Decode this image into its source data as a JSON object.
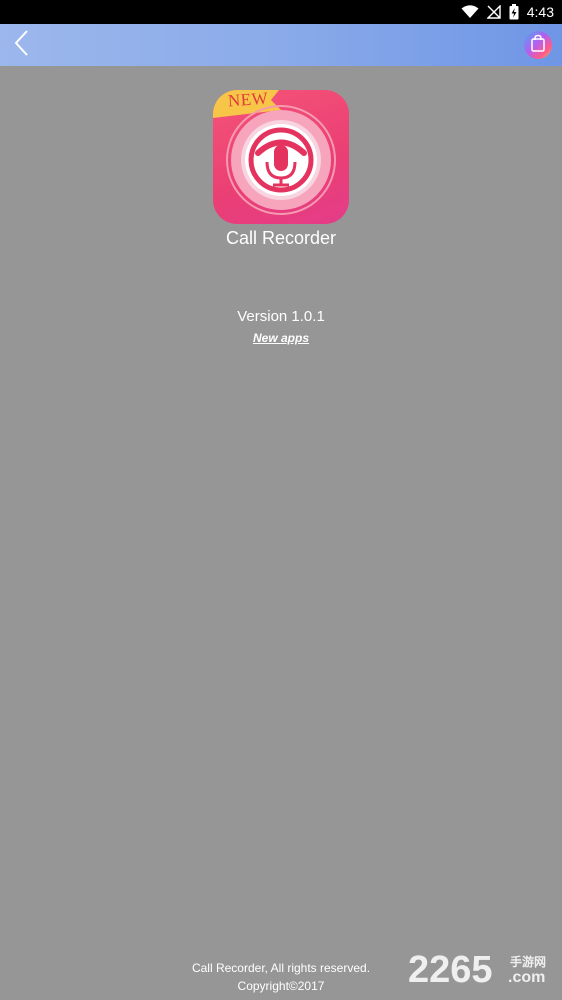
{
  "status_bar": {
    "time": "4:43",
    "icons": [
      "wifi-icon",
      "no-signal-icon",
      "battery-charging-icon"
    ]
  },
  "toolbar": {
    "back_icon": "chevron-left-icon",
    "store_icon": "shopping-bag-icon"
  },
  "app": {
    "icon_badge": "NEW",
    "name": "Call Recorder",
    "version": "Version 1.0.1",
    "new_apps_link": "New apps"
  },
  "footer": {
    "rights": "Call Recorder, All rights reserved.",
    "copyright": "Copyright©2017"
  },
  "watermark": {
    "brand": "2265",
    "cn": "手游网",
    "domain": ".com"
  },
  "colors": {
    "background": "#969696",
    "toolbar_start": "#9cb7ec",
    "toolbar_end": "#6f96e6",
    "app_icon_primary": "#ea3f74",
    "badge_yellow": "#f7c548"
  }
}
